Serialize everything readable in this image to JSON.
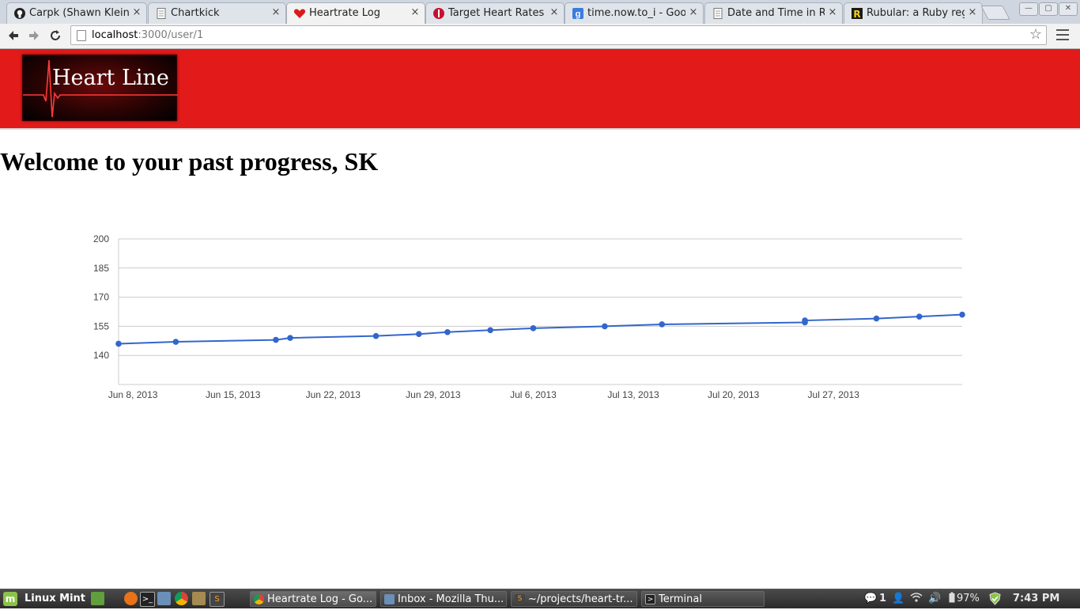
{
  "browser": {
    "tabs": [
      {
        "title": "Carpk (Shawn Klein)",
        "icon": "github-icon",
        "active": false
      },
      {
        "title": "Chartkick",
        "icon": "page-icon",
        "active": false
      },
      {
        "title": "Heartrate Log",
        "icon": "heart-icon",
        "active": true
      },
      {
        "title": "Target Heart Rates",
        "icon": "heart-org-icon",
        "active": false
      },
      {
        "title": "time.now.to_i - Goog",
        "icon": "google-icon",
        "active": false
      },
      {
        "title": "Date and Time in Ru",
        "icon": "page-icon",
        "active": false
      },
      {
        "title": "Rubular: a Ruby regu",
        "icon": "rubular-icon",
        "active": false
      }
    ],
    "url_host": "localhost",
    "url_path": ":3000/user/1",
    "close_glyph": "×"
  },
  "page": {
    "logo_text": "Heart Line",
    "heading": "Welcome to your past progress, SK",
    "banner_color": "#e21a1a"
  },
  "chart_data": {
    "type": "line",
    "series": [
      {
        "x": [
          "2013-06-07",
          "2013-06-11",
          "2013-06-18",
          "2013-06-19",
          "2013-06-25",
          "2013-06-28",
          "2013-06-30",
          "2013-07-03",
          "2013-07-06",
          "2013-07-11",
          "2013-07-15",
          "2013-07-25",
          "2013-07-25",
          "2013-07-30",
          "2013-08-02",
          "2013-08-05"
        ],
        "y": [
          146,
          147,
          148,
          149,
          150,
          151,
          152,
          153,
          154,
          155,
          156,
          157,
          158,
          159,
          160,
          161
        ],
        "color": "#3366cc"
      }
    ],
    "xticks": [
      "Jun 8, 2013",
      "Jun 15, 2013",
      "Jun 22, 2013",
      "Jun 29, 2013",
      "Jul 6, 2013",
      "Jul 13, 2013",
      "Jul 20, 2013",
      "Jul 27, 2013"
    ],
    "yticks": [
      "200",
      "185",
      "170",
      "155",
      "140"
    ],
    "ylim": [
      125,
      200
    ],
    "xlim": [
      "2013-06-07",
      "2013-08-05"
    ],
    "grid": true,
    "legend": "none"
  },
  "taskbar": {
    "menu_label": "Linux Mint",
    "windows": [
      {
        "label": "Heartrate Log - Go...",
        "icon": "chrome-icon",
        "active": true
      },
      {
        "label": "Inbox - Mozilla Thu...",
        "icon": "thunderbird-icon",
        "active": false
      },
      {
        "label": "~/projects/heart-tr...",
        "icon": "sublime-icon",
        "active": false
      },
      {
        "label": "Terminal",
        "icon": "terminal-icon",
        "active": false
      }
    ],
    "notification_count": "1",
    "battery": "97%",
    "clock": "7:43 PM"
  }
}
